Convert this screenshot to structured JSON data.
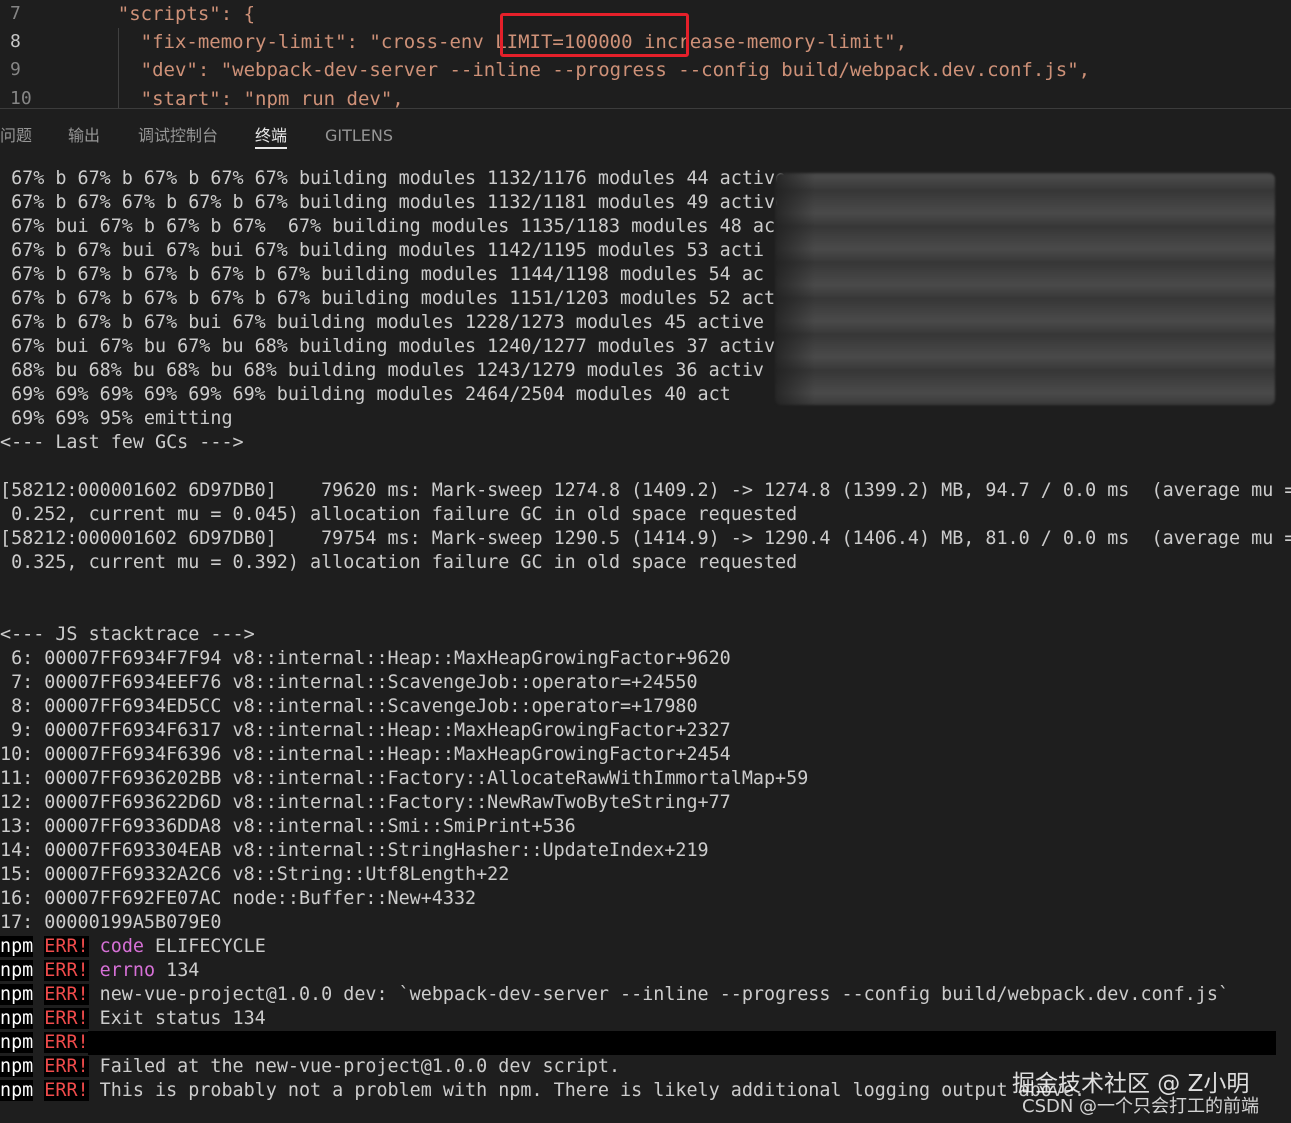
{
  "editor": {
    "line_numbers": [
      "7",
      "8",
      "9",
      "10"
    ],
    "lines": [
      "    \"scripts\": {",
      "      \"fix-memory-limit\": \"cross-env LIMIT=100000 increase-memory-limit\",",
      "      \"dev\": \"webpack-dev-server --inline --progress --config build/webpack.dev.conf.js\",",
      "      \"start\": \"npm run dev\","
    ]
  },
  "panel": {
    "tabs": [
      "问题",
      "输出",
      "调试控制台",
      "终端",
      "GITLENS"
    ],
    "active_tab": "终端"
  },
  "terminal": {
    "progress_lines": [
      " 67% b 67% b 67% b 67% 67% building modules 1132/1176 modules 44 active",
      " 67% b 67% 67% b 67% b 67% building modules 1132/1181 modules 49 active",
      " 67% bui 67% b 67% b 67%  67% building modules 1135/1183 modules 48 ac",
      " 67% b 67% bui 67% bui 67% building modules 1142/1195 modules 53 acti",
      " 67% b 67% b 67% b 67% b 67% building modules 1144/1198 modules 54 ac",
      " 67% b 67% b 67% b 67% b 67% building modules 1151/1203 modules 52 act",
      " 67% b 67% b 67% bui 67% building modules 1228/1273 modules 45 active",
      " 67% bui 67% bu 67% bu 68% building modules 1240/1277 modules 37 activ",
      " 68% bu 68% bu 68% bu 68% building modules 1243/1279 modules 36 activ",
      " 69% 69% 69% 69% 69% 69% building modules 2464/2504 modules 40 act",
      " 69% 69% 95% emitting"
    ],
    "gc_header": "<--- Last few GCs --->",
    "gc_lines": [
      "[58212:000001602 6D97DB0]    79620 ms: Mark-sweep 1274.8 (1409.2) -> 1274.8 (1399.2) MB, 94.7 / 0.0 ms  (average mu =",
      " 0.252, current mu = 0.045) allocation failure GC in old space requested",
      "[58212:000001602 6D97DB0]    79754 ms: Mark-sweep 1290.5 (1414.9) -> 1290.4 (1406.4) MB, 81.0 / 0.0 ms  (average mu =",
      " 0.325, current mu = 0.392) allocation failure GC in old space requested"
    ],
    "js_header": "<--- JS stacktrace --->",
    "stack_lines": [
      " 6: 00007FF6934F7F94 v8::internal::Heap::MaxHeapGrowingFactor+9620",
      " 7: 00007FF6934EEF76 v8::internal::ScavengeJob::operator=+24550",
      " 8: 00007FF6934ED5CC v8::internal::ScavengeJob::operator=+17980",
      " 9: 00007FF6934F6317 v8::internal::Heap::MaxHeapGrowingFactor+2327",
      "10: 00007FF6934F6396 v8::internal::Heap::MaxHeapGrowingFactor+2454",
      "11: 00007FF6936202BB v8::internal::Factory::AllocateRawWithImmortalMap+59",
      "12: 00007FF693622D6D v8::internal::Factory::NewRawTwoByteString+77",
      "13: 00007FF69336DDA8 v8::internal::Smi::SmiPrint+536",
      "14: 00007FF693304EAB v8::internal::StringHasher::UpdateIndex+219",
      "15: 00007FF69332A2C6 v8::String::Utf8Length+22",
      "16: 00007FF692FE07AC node::Buffer::New+4332",
      "17: 00000199A5B079E0"
    ],
    "npm_lines": [
      {
        "prefix": "npm",
        "tag": "ERR!",
        "key": "code",
        "text": " ELIFECYCLE"
      },
      {
        "prefix": "npm",
        "tag": "ERR!",
        "key": "errno",
        "text": " 134"
      },
      {
        "prefix": "npm",
        "tag": "ERR!",
        "key": "",
        "text": " new-vue-project@1.0.0 dev: `webpack-dev-server --inline --progress --config build/webpack.dev.conf.js`"
      },
      {
        "prefix": "npm",
        "tag": "ERR!",
        "key": "",
        "text": " Exit status 134"
      },
      {
        "prefix": "npm",
        "tag": "ERR!",
        "key": "",
        "text": ""
      },
      {
        "prefix": "npm",
        "tag": "ERR!",
        "key": "",
        "text": " Failed at the new-vue-project@1.0.0 dev script."
      },
      {
        "prefix": "npm",
        "tag": "ERR!",
        "key": "",
        "text": " This is probably not a problem with npm. There is likely additional logging output above."
      }
    ]
  },
  "watermark": {
    "line1": "掘金技术社区 @ Z小明",
    "line2": "CSDN @一个只会打工的前端"
  }
}
